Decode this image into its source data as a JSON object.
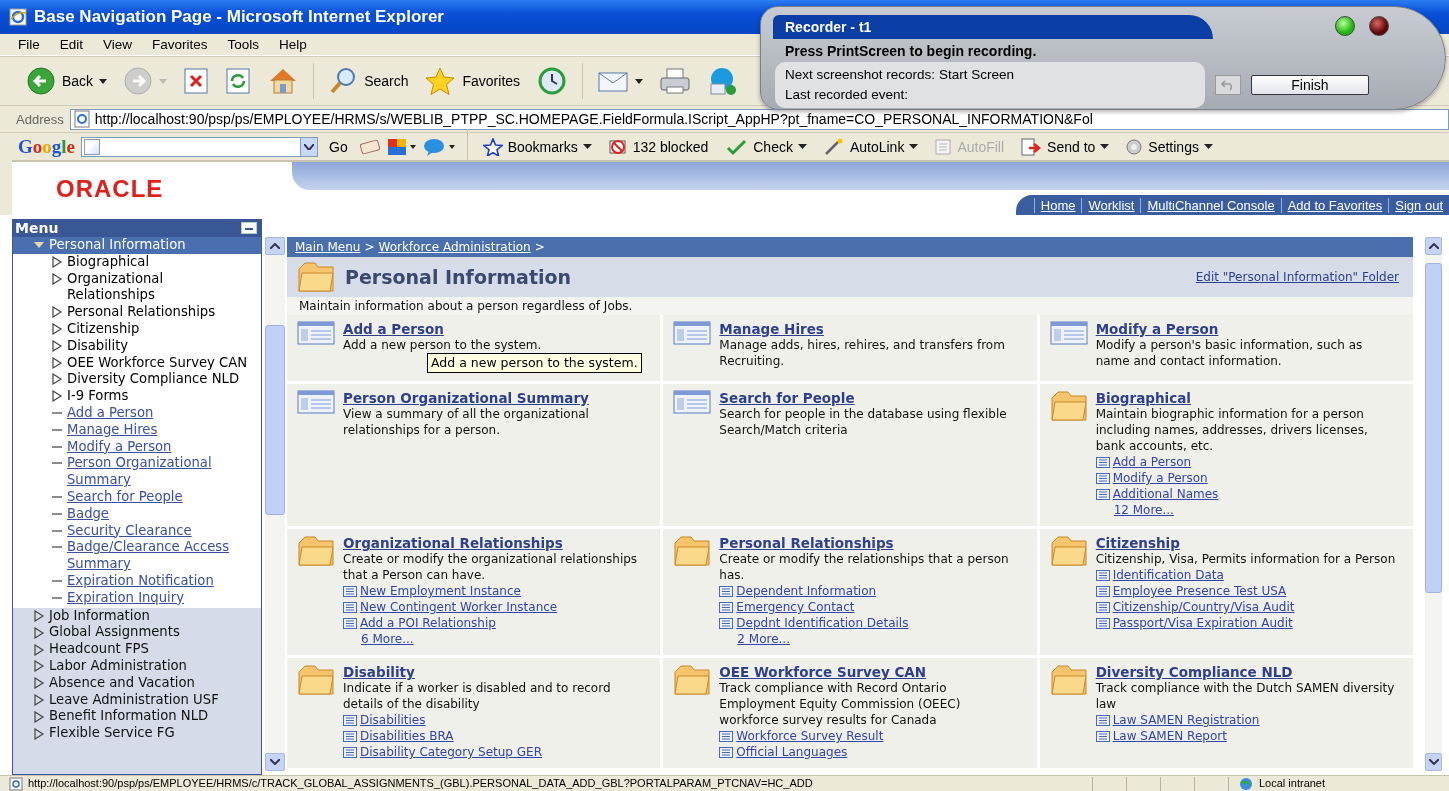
{
  "window": {
    "title": "Base Navigation Page - Microsoft Internet Explorer"
  },
  "menu_bar": [
    "File",
    "Edit",
    "View",
    "Favorites",
    "Tools",
    "Help"
  ],
  "toolbar": [
    {
      "kind": "back",
      "label": "Back",
      "dropdown": true,
      "disabled": false
    },
    {
      "kind": "forward",
      "dropdown": true,
      "disabled": true
    },
    {
      "kind": "stop",
      "dropdown": false,
      "disabled": false
    },
    {
      "kind": "refresh",
      "dropdown": false,
      "disabled": false
    },
    {
      "kind": "home",
      "dropdown": false,
      "disabled": false
    },
    {
      "kind": "search",
      "label": "Search",
      "dropdown": false,
      "disabled": false
    },
    {
      "kind": "favorites",
      "label": "Favorites",
      "dropdown": false,
      "disabled": false
    },
    {
      "kind": "history",
      "dropdown": false,
      "disabled": false
    },
    {
      "kind": "mail",
      "dropdown": true,
      "disabled": false
    },
    {
      "kind": "print",
      "dropdown": false,
      "disabled": false
    },
    {
      "kind": "messenger",
      "dropdown": false,
      "disabled": false
    }
  ],
  "address": {
    "label": "Address",
    "value": "http://localhost:90/psp/ps/EMPLOYEE/HRMS/s/WEBLIB_PTPP_SC.HOMEPAGE.FieldFormula.IScript_AppHP?pt_fname=CO_PERSONAL_INFORMATION&Fol"
  },
  "google_toolbar": {
    "logo": "Google",
    "go": "Go",
    "buttons": [
      {
        "label": "Bookmarks",
        "dropdown": true,
        "disabled": false
      },
      {
        "label": "132 blocked",
        "dropdown": false,
        "disabled": false
      },
      {
        "label": "Check",
        "dropdown": true,
        "disabled": false
      },
      {
        "label": "AutoLink",
        "dropdown": true,
        "disabled": false
      },
      {
        "label": "AutoFill",
        "dropdown": false,
        "disabled": true
      },
      {
        "label": "Send to",
        "dropdown": true,
        "disabled": false
      },
      {
        "label": "Settings",
        "dropdown": true,
        "disabled": false
      }
    ]
  },
  "recorder": {
    "title": "Recorder - t1",
    "instruction": "Press PrintScreen to begin recording.",
    "next_label": "Next screenshot records:",
    "next_value": "Start Screen",
    "last_label": "Last recorded event:",
    "finish": "Finish"
  },
  "header": {
    "logo": "ORACLE",
    "links": [
      "Home",
      "Worklist",
      "MultiChannel Console",
      "Add to Favorites",
      "Sign out"
    ]
  },
  "menu": {
    "title": "Menu",
    "items": [
      {
        "label": "Personal Information",
        "expanded": true,
        "selected": true,
        "children": [
          {
            "kind": "folder",
            "label": "Biographical"
          },
          {
            "kind": "folder",
            "label": "Organizational Relationships"
          },
          {
            "kind": "folder",
            "label": "Personal Relationships"
          },
          {
            "kind": "folder",
            "label": "Citizenship"
          },
          {
            "kind": "folder",
            "label": "Disability"
          },
          {
            "kind": "folder",
            "label": "OEE Workforce Survey CAN"
          },
          {
            "kind": "folder",
            "label": "Diversity Compliance NLD"
          },
          {
            "kind": "folder",
            "label": "I-9 Forms"
          },
          {
            "kind": "link",
            "label": "Add a Person"
          },
          {
            "kind": "link",
            "label": "Manage Hires"
          },
          {
            "kind": "link",
            "label": "Modify a Person"
          },
          {
            "kind": "link",
            "label": "Person Organizational Summary"
          },
          {
            "kind": "link",
            "label": "Search for People"
          },
          {
            "kind": "link",
            "label": "Badge"
          },
          {
            "kind": "link",
            "label": "Security Clearance"
          },
          {
            "kind": "link",
            "label": "Badge/Clearance Access Summary"
          },
          {
            "kind": "link",
            "label": "Expiration Notification"
          },
          {
            "kind": "link",
            "label": "Expiration Inquiry"
          }
        ]
      },
      {
        "label": "Job Information",
        "expanded": false,
        "selected": false
      },
      {
        "label": "Global Assignments",
        "expanded": false,
        "selected": false
      },
      {
        "label": "Headcount FPS",
        "expanded": false,
        "selected": false
      },
      {
        "label": "Labor Administration",
        "expanded": false,
        "selected": false
      },
      {
        "label": "Absence and Vacation",
        "expanded": false,
        "selected": false
      },
      {
        "label": "Leave Administration USF",
        "expanded": false,
        "selected": false
      },
      {
        "label": "Benefit Information NLD",
        "expanded": false,
        "selected": false
      },
      {
        "label": "Flexible Service FG",
        "expanded": false,
        "selected": false
      }
    ]
  },
  "breadcrumb": {
    "items": [
      "Main Menu",
      "Workforce Administration"
    ],
    "separator": ">"
  },
  "page": {
    "title": "Personal Information",
    "edit_link": "Edit \"Personal Information\" Folder",
    "description": "Maintain information about a person regardless of Jobs."
  },
  "tooltip": "Add a new person to the system.",
  "cards": [
    {
      "kind": "component",
      "title": "Add a Person",
      "description": "Add a new person to the system."
    },
    {
      "kind": "component",
      "title": "Manage Hires",
      "description": "Manage adds, hires, rehires, and transfers from Recruiting."
    },
    {
      "kind": "component",
      "title": "Modify a Person",
      "description": "Modify a person's basic information, such as name and contact information."
    },
    {
      "kind": "component",
      "title": "Person Organizational Summary",
      "description": "View a summary of all the organizational relationships for a person."
    },
    {
      "kind": "component",
      "title": "Search for People",
      "description": "Search for people in the database using flexible Search/Match criteria"
    },
    {
      "kind": "folder",
      "title": "Biographical",
      "description": "Maintain biographic information for a person including names, addresses, drivers licenses, bank accounts, etc.",
      "links": [
        "Add a Person",
        "Modify a Person",
        "Additional Names"
      ],
      "more": "12 More..."
    },
    {
      "kind": "folder",
      "title": "Organizational Relationships",
      "description": "Create or modify the organizational relationships that a Person can have.",
      "links": [
        "New Employment Instance",
        "New Contingent Worker Instance",
        "Add a POI Relationship"
      ],
      "more": "6 More..."
    },
    {
      "kind": "folder",
      "title": "Personal Relationships",
      "description": "Create or modify the relationships that a person has.",
      "links": [
        "Dependent Information",
        "Emergency Contact",
        "Depdnt Identification Details"
      ],
      "more": "2 More..."
    },
    {
      "kind": "folder",
      "title": "Citizenship",
      "description": "Citizenship, Visa, Permits information for a Person",
      "links": [
        "Identification Data",
        "Employee Presence Test USA",
        "Citizenship/Country/Visa Audit",
        "Passport/Visa Expiration Audit"
      ]
    },
    {
      "kind": "folder",
      "title": "Disability",
      "description": "Indicate if a worker is disabled and to record details of the disability",
      "links": [
        "Disabilities",
        "Disabilities BRA",
        "Disability Category Setup GER"
      ]
    },
    {
      "kind": "folder",
      "title": "OEE Workforce Survey CAN",
      "description": "Track compliance with Record Ontario Employment Equity Commission (OEEC) workforce survey results for Canada",
      "links": [
        "Workforce Survey Result",
        "Official Languages"
      ]
    },
    {
      "kind": "folder",
      "title": "Diversity Compliance NLD",
      "description": "Track compliance with the Dutch SAMEN diversity law",
      "links": [
        "Law SAMEN Registration",
        "Law SAMEN Report"
      ]
    }
  ],
  "status_bar": {
    "url": "http://localhost:90/psp/ps/EMPLOYEE/HRMS/c/TRACK_GLOBAL_ASSIGNMENTS_(GBL).PERSONAL_DATA_ADD_GBL?PORTALPARAM_PTCNAV=HC_ADD",
    "zone": "Local intranet"
  }
}
